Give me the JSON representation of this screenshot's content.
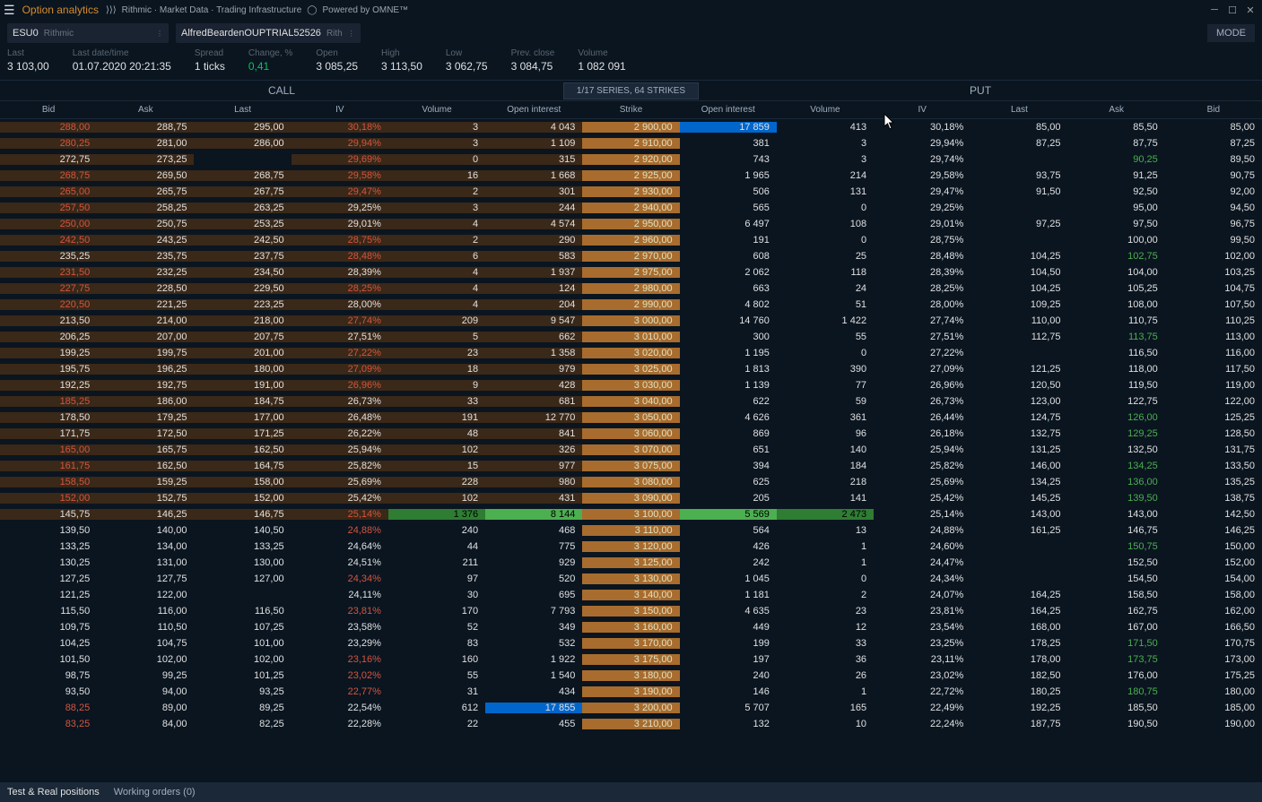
{
  "window": {
    "title": "Option analytics",
    "branding": "Rithmic · Market Data · Trading Infrastructure",
    "powered": "Powered by OMNE™"
  },
  "toolbar": {
    "symbol": "ESU0",
    "exchange": "Rithmic",
    "account": "AlfredBeardenOUPTRIAL52526",
    "account_exch": "Rith",
    "mode_label": "MODE"
  },
  "stats": {
    "last_label": "Last",
    "last": "3 103,00",
    "lastdate_label": "Last date/time",
    "lastdate": "01.07.2020 20:21:35",
    "spread_label": "Spread",
    "spread": "1 ticks",
    "change_label": "Change, %",
    "change": "0,41",
    "open_label": "Open",
    "open": "3 085,25",
    "high_label": "High",
    "high": "3 113,50",
    "low_label": "Low",
    "low": "3 062,75",
    "prev_label": "Prev. close",
    "prev": "3 084,75",
    "vol_label": "Volume",
    "vol": "1 082 091"
  },
  "sections": {
    "call": "CALL",
    "series": "1/17 SERIES, 64 STRIKES",
    "put": "PUT"
  },
  "columns": {
    "bid": "Bid",
    "ask": "Ask",
    "last": "Last",
    "iv": "IV",
    "volume": "Volume",
    "oi": "Open interest",
    "strike": "Strike"
  },
  "footer": {
    "tab1": "Test & Real positions",
    "tab2": "Working orders (0)"
  },
  "rows": [
    {
      "cb": "288,00",
      "cbr": 1,
      "ca": "288,75",
      "cl": "295,00",
      "civ": "30,18%",
      "civr": 1,
      "cv": "3",
      "coi": "4 043",
      "strike": "2 900,00",
      "poi": "17 859",
      "poih": "blue",
      "pv": "413",
      "piv": "30,18%",
      "pl": "85,00",
      "pa": "85,50",
      "pb": "85,00"
    },
    {
      "cb": "280,25",
      "cbr": 1,
      "ca": "281,00",
      "cl": "286,00",
      "civ": "29,94%",
      "civr": 1,
      "cv": "3",
      "coi": "1 109",
      "strike": "2 910,00",
      "poi": "381",
      "pv": "3",
      "piv": "29,94%",
      "pl": "87,25",
      "pa": "87,75",
      "pb": "87,25"
    },
    {
      "cb": "272,75",
      "ca": "273,25",
      "cl": "",
      "civ": "29,69%",
      "civr": 1,
      "cv": "0",
      "coi": "315",
      "strike": "2 920,00",
      "poi": "743",
      "pv": "3",
      "piv": "29,74%",
      "pl": "",
      "pa": "90,25",
      "pag": 1,
      "pb": "89,50"
    },
    {
      "cb": "268,75",
      "cbr": 1,
      "ca": "269,50",
      "cl": "268,75",
      "civ": "29,58%",
      "civr": 1,
      "cv": "16",
      "coi": "1 668",
      "strike": "2 925,00",
      "poi": "1 965",
      "pv": "214",
      "piv": "29,58%",
      "pl": "93,75",
      "pa": "91,25",
      "pb": "90,75"
    },
    {
      "cb": "265,00",
      "cbr": 1,
      "ca": "265,75",
      "cl": "267,75",
      "civ": "29,47%",
      "civr": 1,
      "cv": "2",
      "coi": "301",
      "strike": "2 930,00",
      "poi": "506",
      "pv": "131",
      "piv": "29,47%",
      "pl": "91,50",
      "pa": "92,50",
      "pb": "92,00"
    },
    {
      "cb": "257,50",
      "cbr": 1,
      "ca": "258,25",
      "cl": "263,25",
      "civ": "29,25%",
      "cv": "3",
      "coi": "244",
      "strike": "2 940,00",
      "poi": "565",
      "pv": "0",
      "piv": "29,25%",
      "pl": "",
      "pa": "95,00",
      "pb": "94,50"
    },
    {
      "cb": "250,00",
      "cbr": 1,
      "ca": "250,75",
      "cl": "253,25",
      "civ": "29,01%",
      "cv": "4",
      "coi": "4 574",
      "strike": "2 950,00",
      "poi": "6 497",
      "pv": "108",
      "piv": "29,01%",
      "pl": "97,25",
      "pa": "97,50",
      "pb": "96,75"
    },
    {
      "cb": "242,50",
      "cbr": 1,
      "ca": "243,25",
      "cl": "242,50",
      "civ": "28,75%",
      "civr": 1,
      "cv": "2",
      "coi": "290",
      "strike": "2 960,00",
      "poi": "191",
      "pv": "0",
      "piv": "28,75%",
      "pl": "",
      "pa": "100,00",
      "pb": "99,50"
    },
    {
      "cb": "235,25",
      "ca": "235,75",
      "cl": "237,75",
      "civ": "28,48%",
      "civr": 1,
      "cv": "6",
      "coi": "583",
      "strike": "2 970,00",
      "poi": "608",
      "pv": "25",
      "piv": "28,48%",
      "pl": "104,25",
      "pa": "102,75",
      "pag": 1,
      "pb": "102,00"
    },
    {
      "cb": "231,50",
      "cbr": 1,
      "ca": "232,25",
      "cl": "234,50",
      "civ": "28,39%",
      "cv": "4",
      "coi": "1 937",
      "strike": "2 975,00",
      "poi": "2 062",
      "pv": "118",
      "piv": "28,39%",
      "pl": "104,50",
      "pa": "104,00",
      "pb": "103,25"
    },
    {
      "cb": "227,75",
      "cbr": 1,
      "ca": "228,50",
      "cl": "229,50",
      "civ": "28,25%",
      "civr": 1,
      "cv": "4",
      "coi": "124",
      "strike": "2 980,00",
      "poi": "663",
      "pv": "24",
      "piv": "28,25%",
      "pl": "104,25",
      "pa": "105,25",
      "pb": "104,75"
    },
    {
      "cb": "220,50",
      "cbr": 1,
      "ca": "221,25",
      "cl": "223,25",
      "civ": "28,00%",
      "cv": "4",
      "coi": "204",
      "strike": "2 990,00",
      "poi": "4 802",
      "pv": "51",
      "piv": "28,00%",
      "pl": "109,25",
      "pa": "108,00",
      "pb": "107,50"
    },
    {
      "cb": "213,50",
      "ca": "214,00",
      "cl": "218,00",
      "civ": "27,74%",
      "civr": 1,
      "cv": "209",
      "coi": "9 547",
      "strike": "3 000,00",
      "poi": "14 760",
      "pv": "1 422",
      "piv": "27,74%",
      "pl": "110,00",
      "pa": "110,75",
      "pb": "110,25"
    },
    {
      "cb": "206,25",
      "ca": "207,00",
      "cl": "207,75",
      "civ": "27,51%",
      "cv": "5",
      "coi": "662",
      "strike": "3 010,00",
      "poi": "300",
      "pv": "55",
      "piv": "27,51%",
      "pl": "112,75",
      "pa": "113,75",
      "pag": 1,
      "pb": "113,00"
    },
    {
      "cb": "199,25",
      "ca": "199,75",
      "cl": "201,00",
      "civ": "27,22%",
      "civr": 1,
      "cv": "23",
      "coi": "1 358",
      "strike": "3 020,00",
      "poi": "1 195",
      "pv": "0",
      "piv": "27,22%",
      "pl": "",
      "pa": "116,50",
      "pb": "116,00"
    },
    {
      "cb": "195,75",
      "ca": "196,25",
      "cl": "180,00",
      "civ": "27,09%",
      "civr": 1,
      "cv": "18",
      "coi": "979",
      "strike": "3 025,00",
      "poi": "1 813",
      "pv": "390",
      "piv": "27,09%",
      "pl": "121,25",
      "pa": "118,00",
      "pb": "117,50"
    },
    {
      "cb": "192,25",
      "ca": "192,75",
      "cl": "191,00",
      "civ": "26,96%",
      "civr": 1,
      "cv": "9",
      "coi": "428",
      "strike": "3 030,00",
      "poi": "1 139",
      "pv": "77",
      "piv": "26,96%",
      "pl": "120,50",
      "pa": "119,50",
      "pb": "119,00"
    },
    {
      "cb": "185,25",
      "cbr": 1,
      "ca": "186,00",
      "cl": "184,75",
      "civ": "26,73%",
      "cv": "33",
      "coi": "681",
      "strike": "3 040,00",
      "poi": "622",
      "pv": "59",
      "piv": "26,73%",
      "pl": "123,00",
      "pa": "122,75",
      "pb": "122,00"
    },
    {
      "cb": "178,50",
      "ca": "179,25",
      "cl": "177,00",
      "civ": "26,48%",
      "cv": "191",
      "coi": "12 770",
      "strike": "3 050,00",
      "poi": "4 626",
      "pv": "361",
      "piv": "26,44%",
      "pl": "124,75",
      "pa": "126,00",
      "pag": 1,
      "pb": "125,25"
    },
    {
      "cb": "171,75",
      "ca": "172,50",
      "cl": "171,25",
      "civ": "26,22%",
      "cv": "48",
      "coi": "841",
      "strike": "3 060,00",
      "poi": "869",
      "pv": "96",
      "piv": "26,18%",
      "pl": "132,75",
      "pa": "129,25",
      "pag": 1,
      "pb": "128,50"
    },
    {
      "cb": "165,00",
      "cbr": 1,
      "ca": "165,75",
      "cl": "162,50",
      "civ": "25,94%",
      "cv": "102",
      "coi": "326",
      "strike": "3 070,00",
      "poi": "651",
      "pv": "140",
      "piv": "25,94%",
      "pl": "131,25",
      "pa": "132,50",
      "pb": "131,75"
    },
    {
      "cb": "161,75",
      "cbr": 1,
      "ca": "162,50",
      "cl": "164,75",
      "civ": "25,82%",
      "cv": "15",
      "coi": "977",
      "strike": "3 075,00",
      "poi": "394",
      "pv": "184",
      "piv": "25,82%",
      "pl": "146,00",
      "pa": "134,25",
      "pag": 1,
      "pb": "133,50"
    },
    {
      "cb": "158,50",
      "cbr": 1,
      "ca": "159,25",
      "cl": "158,00",
      "civ": "25,69%",
      "cv": "228",
      "coi": "980",
      "strike": "3 080,00",
      "poi": "625",
      "pv": "218",
      "piv": "25,69%",
      "pl": "134,25",
      "pa": "136,00",
      "pag": 1,
      "pb": "135,25"
    },
    {
      "cb": "152,00",
      "cbr": 1,
      "ca": "152,75",
      "cl": "152,00",
      "civ": "25,42%",
      "cv": "102",
      "coi": "431",
      "strike": "3 090,00",
      "poi": "205",
      "pv": "141",
      "piv": "25,42%",
      "pl": "145,25",
      "pa": "139,50",
      "pag": 1,
      "pb": "138,75"
    },
    {
      "atm": 1,
      "cb": "145,75",
      "ca": "146,25",
      "cl": "146,75",
      "civ": "25,14%",
      "civr": 1,
      "cv": "1 376",
      "cvh": "green",
      "coi": "8 144",
      "strike": "3 100,00",
      "poi": "5 569",
      "pv": "2 473",
      "pvh": "green",
      "piv": "25,14%",
      "pl": "143,00",
      "pa": "143,00",
      "pb": "142,50"
    },
    {
      "lower": 1,
      "cb": "139,50",
      "ca": "140,00",
      "cl": "140,50",
      "civ": "24,88%",
      "civr": 1,
      "cv": "240",
      "coi": "468",
      "strike": "3 110,00",
      "poi": "564",
      "pv": "13",
      "piv": "24,88%",
      "pl": "161,25",
      "pa": "146,75",
      "pb": "146,25"
    },
    {
      "lower": 1,
      "cb": "133,25",
      "ca": "134,00",
      "cl": "133,25",
      "civ": "24,64%",
      "cv": "44",
      "coi": "775",
      "strike": "3 120,00",
      "poi": "426",
      "pv": "1",
      "piv": "24,60%",
      "pl": "",
      "pa": "150,75",
      "pag": 1,
      "pb": "150,00"
    },
    {
      "lower": 1,
      "cb": "130,25",
      "ca": "131,00",
      "cl": "130,00",
      "civ": "24,51%",
      "cv": "211",
      "coi": "929",
      "strike": "3 125,00",
      "poi": "242",
      "pv": "1",
      "piv": "24,47%",
      "pl": "",
      "pa": "152,50",
      "pb": "152,00"
    },
    {
      "lower": 1,
      "cb": "127,25",
      "ca": "127,75",
      "cl": "127,00",
      "civ": "24,34%",
      "civr": 1,
      "cv": "97",
      "coi": "520",
      "strike": "3 130,00",
      "poi": "1 045",
      "pv": "0",
      "piv": "24,34%",
      "pl": "",
      "pa": "154,50",
      "pb": "154,00"
    },
    {
      "lower": 1,
      "cb": "121,25",
      "ca": "122,00",
      "cl": "",
      "civ": "24,11%",
      "cv": "30",
      "coi": "695",
      "strike": "3 140,00",
      "poi": "1 181",
      "pv": "2",
      "piv": "24,07%",
      "pl": "164,25",
      "pa": "158,50",
      "pb": "158,00"
    },
    {
      "lower": 1,
      "cb": "115,50",
      "ca": "116,00",
      "cl": "116,50",
      "civ": "23,81%",
      "civr": 1,
      "cv": "170",
      "coi": "7 793",
      "strike": "3 150,00",
      "poi": "4 635",
      "pv": "23",
      "piv": "23,81%",
      "pl": "164,25",
      "pa": "162,75",
      "pb": "162,00"
    },
    {
      "lower": 1,
      "cb": "109,75",
      "ca": "110,50",
      "cl": "107,25",
      "civ": "23,58%",
      "cv": "52",
      "coi": "349",
      "strike": "3 160,00",
      "poi": "449",
      "pv": "12",
      "piv": "23,54%",
      "pl": "168,00",
      "pa": "167,00",
      "pb": "166,50"
    },
    {
      "lower": 1,
      "cb": "104,25",
      "ca": "104,75",
      "cl": "101,00",
      "civ": "23,29%",
      "cv": "83",
      "coi": "532",
      "strike": "3 170,00",
      "poi": "199",
      "pv": "33",
      "piv": "23,25%",
      "pl": "178,25",
      "pa": "171,50",
      "pag": 1,
      "pb": "170,75"
    },
    {
      "lower": 1,
      "cb": "101,50",
      "ca": "102,00",
      "cl": "102,00",
      "civ": "23,16%",
      "civr": 1,
      "cv": "160",
      "coi": "1 922",
      "strike": "3 175,00",
      "poi": "197",
      "pv": "36",
      "piv": "23,11%",
      "pl": "178,00",
      "pa": "173,75",
      "pag": 1,
      "pb": "173,00"
    },
    {
      "lower": 1,
      "cb": "98,75",
      "ca": "99,25",
      "cl": "101,25",
      "civ": "23,02%",
      "civr": 1,
      "cv": "55",
      "coi": "1 540",
      "strike": "3 180,00",
      "poi": "240",
      "pv": "26",
      "piv": "23,02%",
      "pl": "182,50",
      "pa": "176,00",
      "pb": "175,25"
    },
    {
      "lower": 1,
      "cb": "93,50",
      "ca": "94,00",
      "cl": "93,25",
      "civ": "22,77%",
      "civr": 1,
      "cv": "31",
      "coi": "434",
      "strike": "3 190,00",
      "poi": "146",
      "pv": "1",
      "piv": "22,72%",
      "pl": "180,25",
      "pa": "180,75",
      "pag": 1,
      "pb": "180,00"
    },
    {
      "lower": 1,
      "cb": "88,25",
      "cbr": 1,
      "ca": "89,00",
      "cl": "89,25",
      "civ": "22,54%",
      "cv": "612",
      "coi": "17 855",
      "coih": "blue",
      "strike": "3 200,00",
      "poi": "5 707",
      "pv": "165",
      "piv": "22,49%",
      "pl": "192,25",
      "pa": "185,50",
      "pb": "185,00"
    },
    {
      "lower": 1,
      "cb": "83,25",
      "cbr": 1,
      "ca": "84,00",
      "cl": "82,25",
      "civ": "22,28%",
      "cv": "22",
      "coi": "455",
      "strike": "3 210,00",
      "poi": "132",
      "pv": "10",
      "piv": "22,24%",
      "pl": "187,75",
      "pa": "190,50",
      "pb": "190,00"
    }
  ]
}
